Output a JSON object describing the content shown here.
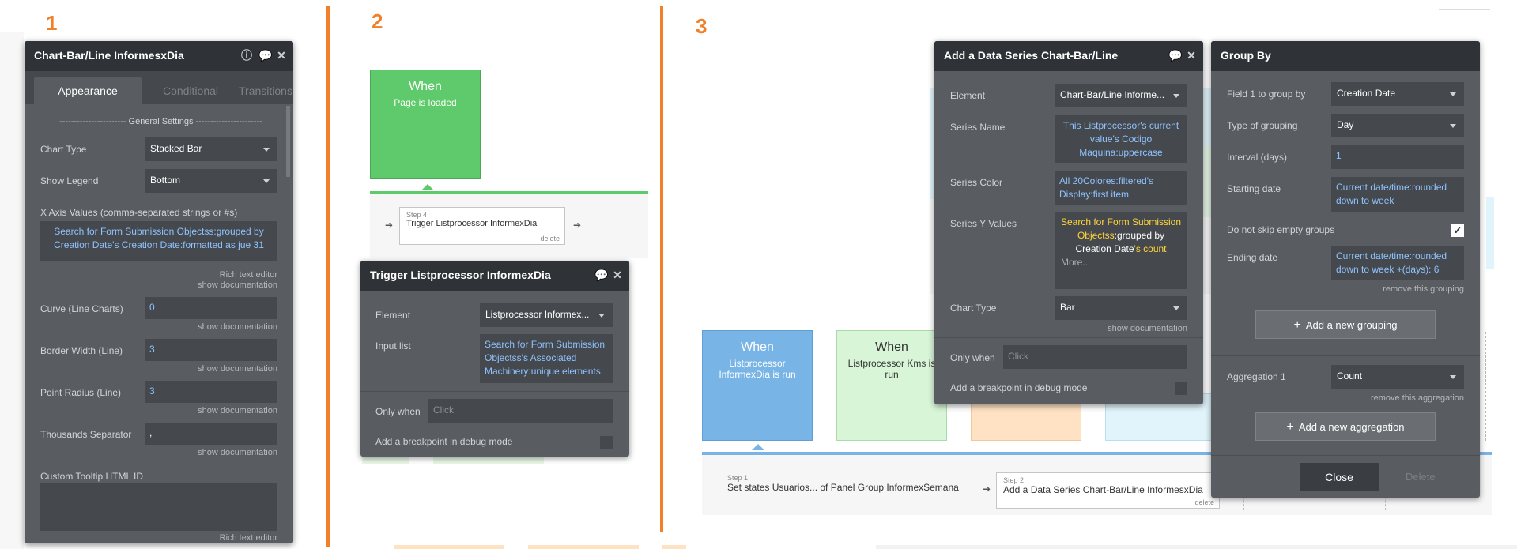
{
  "labels": {
    "n1": "1",
    "n2": "2",
    "n3": "3"
  },
  "panel1": {
    "title": "Chart-Bar/Line InformesxDia",
    "tabs": [
      "Appearance",
      "Conditional",
      "Transitions"
    ],
    "section": "----------------------- General Settings -----------------------",
    "chart_type_label": "Chart Type",
    "chart_type_value": "Stacked Bar",
    "show_legend_label": "Show Legend",
    "show_legend_value": "Bottom",
    "x_axis_label": "X Axis Values (comma-separated strings or #s)",
    "x_axis_value": "Search for Form Submission Objectss:grouped by Creation Date's Creation Date:formatted as jue 31",
    "rich_text": "Rich text editor",
    "show_doc": "show documentation",
    "curve_label": "Curve (Line Charts)",
    "curve_value": "0",
    "border_label": "Border Width (Line)",
    "border_value": "3",
    "radius_label": "Point Radius (Line)",
    "radius_value": "3",
    "thousands_label": "Thousands Separator",
    "thousands_value": ",",
    "tooltip_label": "Custom Tooltip HTML ID",
    "rich_text2": "Rich text editor"
  },
  "workflow2": {
    "when_title": "When",
    "when_sub": "Page is loaded",
    "step_num": "Step 4",
    "step_text": "Trigger Listprocessor InformexDia",
    "step_delete": "delete"
  },
  "panel2": {
    "title": "Trigger Listprocessor InformexDia",
    "element_label": "Element",
    "element_value": "Listprocessor Informex...",
    "input_label": "Input list",
    "input_value": "Search for Form Submission Objectss's Associated Machinery:unique elements",
    "only_when_label": "Only when",
    "only_when_placeholder": "Click",
    "breakpoint_label": "Add a breakpoint in debug mode"
  },
  "workflow3": {
    "when1_title": "When",
    "when1_sub": "Listprocessor InformexDia is run",
    "when2_title": "When",
    "when2_sub": "Listprocessor Kms is run",
    "step1_num": "Step 1",
    "step1_text": "Set states Usuarios... of Panel Group InformexSemana",
    "step2_num": "Step 2",
    "step2_text": "Add a Data Series Chart-Bar/Line InformesxDia",
    "step2_delete": "delete"
  },
  "panel3": {
    "title": "Add a Data Series Chart-Bar/Line",
    "element_label": "Element",
    "element_value": "Chart-Bar/Line Informe...",
    "series_name_label": "Series Name",
    "series_name_value": "This Listprocessor's current value's Codigo Maquina:uppercase",
    "series_color_label": "Series Color",
    "series_color_value": "All 20Colores:filtered's Display:first item",
    "series_y_label": "Series Y Values",
    "series_y_p1": "Search for Form Submission Objectss",
    "series_y_p2": ":grouped by Creation Date",
    "series_y_p3": "'s count",
    "series_y_more": "More...",
    "chart_type_label": "Chart Type",
    "chart_type_value": "Bar",
    "show_doc": "show documentation",
    "only_when_label": "Only when",
    "only_when_placeholder": "Click",
    "breakpoint_label": "Add a breakpoint in debug mode"
  },
  "panel4": {
    "title": "Group By",
    "field1_label": "Field 1 to group by",
    "field1_value": "Creation Date",
    "type_label": "Type of grouping",
    "type_value": "Day",
    "interval_label": "Interval (days)",
    "interval_value": "1",
    "start_label": "Starting date",
    "start_value": "Current date/time:rounded down to week",
    "skip_label": "Do not skip empty groups",
    "skip_check": "✓",
    "end_label": "Ending date",
    "end_value": "Current date/time:rounded down to week +(days): 6",
    "remove_grouping": "remove this grouping",
    "add_grouping": "Add a new grouping",
    "agg_label": "Aggregation 1",
    "agg_value": "Count",
    "remove_agg": "remove this aggregation",
    "add_agg": "Add a new aggregation",
    "close": "Close",
    "delete": "Delete"
  }
}
